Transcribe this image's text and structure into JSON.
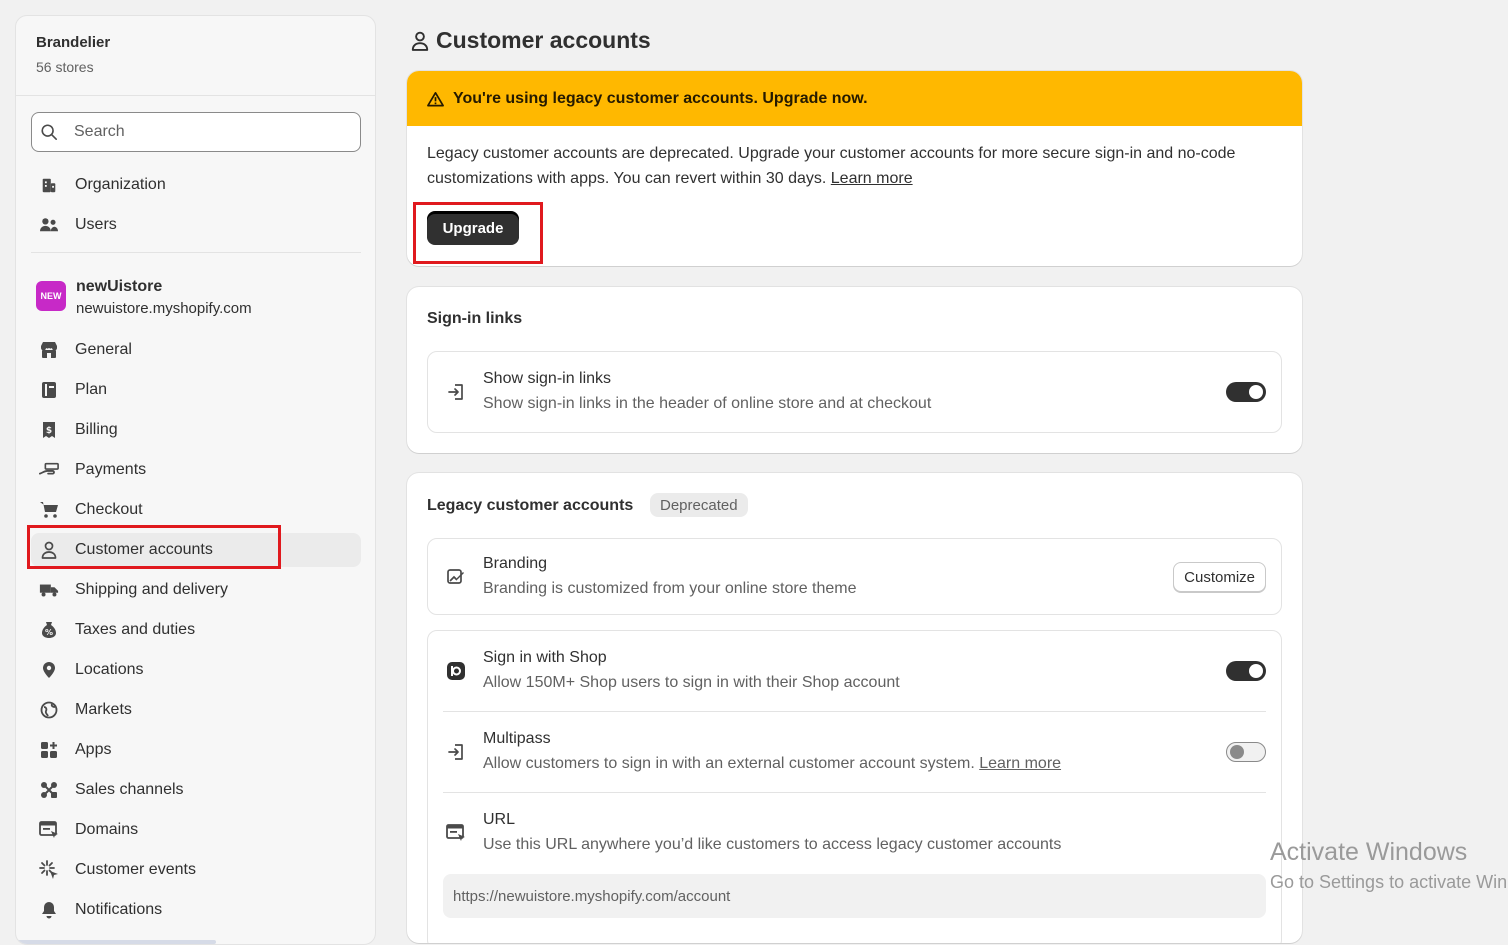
{
  "sidebar": {
    "org_name": "Brandelier",
    "org_stores": "56 stores",
    "search_placeholder": "Search",
    "org_items": [
      {
        "label": "Organization",
        "icon": "building-icon"
      },
      {
        "label": "Users",
        "icon": "users-icon"
      }
    ],
    "store": {
      "badge": "NEW",
      "name": "newUistore",
      "url": "newuistore.myshopify.com"
    },
    "store_items": [
      {
        "label": "General",
        "icon": "store-icon"
      },
      {
        "label": "Plan",
        "icon": "plan-icon"
      },
      {
        "label": "Billing",
        "icon": "receipt-icon"
      },
      {
        "label": "Payments",
        "icon": "payments-icon"
      },
      {
        "label": "Checkout",
        "icon": "cart-icon"
      },
      {
        "label": "Customer accounts",
        "icon": "person-icon",
        "active": true
      },
      {
        "label": "Shipping and delivery",
        "icon": "truck-icon"
      },
      {
        "label": "Taxes and duties",
        "icon": "tax-icon"
      },
      {
        "label": "Locations",
        "icon": "location-pin-icon"
      },
      {
        "label": "Markets",
        "icon": "globe-icon"
      },
      {
        "label": "Apps",
        "icon": "apps-icon"
      },
      {
        "label": "Sales channels",
        "icon": "channels-icon"
      },
      {
        "label": "Domains",
        "icon": "domain-icon"
      },
      {
        "label": "Customer events",
        "icon": "sparkle-icon"
      },
      {
        "label": "Notifications",
        "icon": "bell-icon"
      }
    ]
  },
  "main": {
    "title": "Customer accounts",
    "banner": {
      "heading": "You're using legacy customer accounts. Upgrade now.",
      "body": "Legacy customer accounts are deprecated. Upgrade your customer accounts for more secure sign-in and no-code customizations with apps. You can revert within 30 days.",
      "link": "Learn more",
      "button": "Upgrade",
      "color": "#ffb800"
    },
    "signin_links": {
      "title": "Sign-in links",
      "row_title": "Show sign-in links",
      "row_sub": "Show sign-in links in the header of online store and at checkout",
      "enabled": true
    },
    "legacy": {
      "title": "Legacy customer accounts",
      "badge": "Deprecated",
      "branding": {
        "title": "Branding",
        "sub": "Branding is customized from your online store theme",
        "button": "Customize"
      },
      "shop": {
        "title": "Sign in with Shop",
        "sub": "Allow 150M+ Shop users to sign in with their Shop account",
        "enabled": true
      },
      "multipass": {
        "title": "Multipass",
        "sub": "Allow customers to sign in with an external customer account system.",
        "link": "Learn more",
        "enabled": false
      },
      "url": {
        "title": "URL",
        "sub": "Use this URL anywhere you’d like customers to access legacy customer accounts",
        "value": "https://newuistore.myshopify.com/account"
      }
    }
  },
  "watermark": {
    "line1": "Activate Windows",
    "line2": "Go to Settings to activate Win"
  }
}
